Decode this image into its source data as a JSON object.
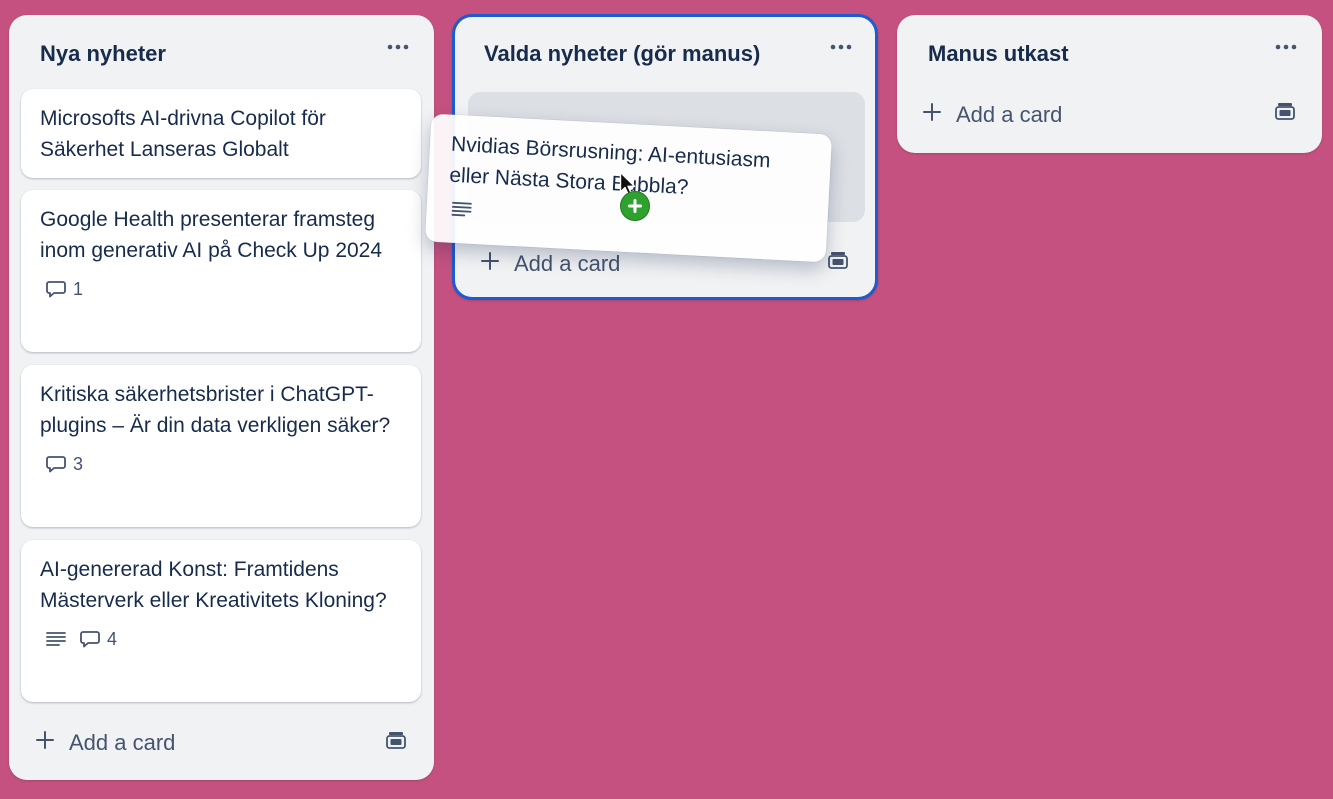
{
  "colors": {
    "board_background": "#c4517f",
    "list_background": "#f1f2f4",
    "card_background": "#ffffff",
    "drop_target_border": "#1d5bd0",
    "copy_indicator": "#2fa12e"
  },
  "lists": [
    {
      "title": "Nya nyheter",
      "menu_icon": "ellipsis-icon",
      "add_card_label": "Add a card",
      "template_icon": "card-template-icon",
      "cards": [
        {
          "title": "Microsofts AI-drivna Copilot för Säkerhet Lanseras Globalt"
        },
        {
          "title": "Google Health presenterar framsteg inom generativ AI på Check Up 2024",
          "comments": "1"
        },
        {
          "title": "Kritiska säkerhetsbrister i ChatGPT-plugins – Är din data verkligen säker?",
          "comments": "3"
        },
        {
          "title": "AI-genererad Konst: Framtidens Mästerverk eller Kreativitets Kloning?",
          "has_description": true,
          "comments": "4"
        }
      ]
    },
    {
      "title": "Valda nyheter (gör manus)",
      "menu_icon": "ellipsis-icon",
      "add_card_label": "Add a card",
      "template_icon": "card-template-icon",
      "drop_target_active": true
    },
    {
      "title": "Manus utkast",
      "menu_icon": "ellipsis-icon",
      "add_card_label": "Add a card",
      "template_icon": "card-template-icon"
    }
  ],
  "dragging_card": {
    "title": "Nvidias Börsrusning: AI-entusiasm eller Nästa Stora Bubbla?",
    "has_description": true,
    "cursor_icon": "pointer-cursor-icon",
    "indicator_icon": "copy-plus-icon"
  }
}
